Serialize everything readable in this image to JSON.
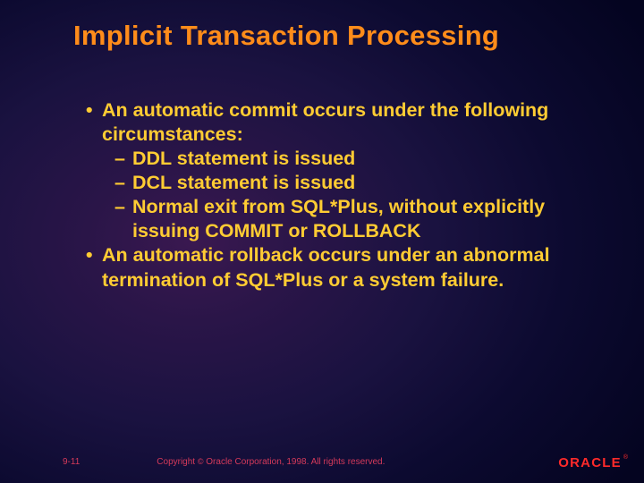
{
  "title": "Implicit Transaction Processing",
  "bullets": {
    "b1": "An automatic commit occurs under the following circumstances:",
    "s1": "DDL statement is issued",
    "s2": "DCL statement is issued",
    "s3": "Normal exit from SQL*Plus, without explicitly issuing COMMIT or ROLLBACK",
    "b2": "An automatic rollback occurs under an abnormal termination of SQL*Plus or a system failure."
  },
  "footer": {
    "page": "9-11",
    "copyright_pre": "Copyright ",
    "copyright_sym": "©",
    "copyright_post": " Oracle Corporation, 1998. All rights reserved."
  },
  "logo": {
    "text": "ORACLE",
    "reg": "®"
  }
}
